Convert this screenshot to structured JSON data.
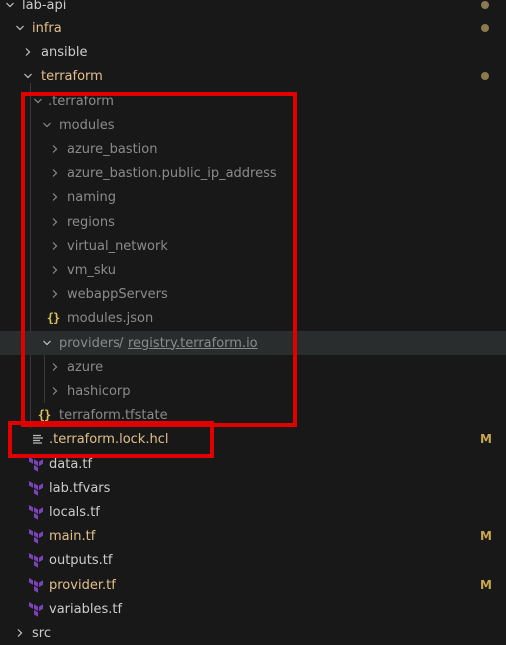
{
  "tree": {
    "lab_api": "lab-api",
    "infra": "infra",
    "ansible": "ansible",
    "terraform": "terraform",
    "dot_terraform": ".terraform",
    "modules": "modules",
    "azure_bastion": "azure_bastion",
    "azure_bastion_pip": "azure_bastion.public_ip_address",
    "naming": "naming",
    "regions": "regions",
    "virtual_network": "virtual_network",
    "vm_sku": "vm_sku",
    "webappServers": "webappServers",
    "modules_json": "modules.json",
    "providers": "providers",
    "providers_sep": "/",
    "registry": "registry.terraform.io",
    "azure": "azure",
    "hashicorp": "hashicorp",
    "tfstate": "terraform.tfstate",
    "lock_hcl": ".terraform.lock.hcl",
    "data_tf": "data.tf",
    "lab_tfvars": "lab.tfvars",
    "locals_tf": "locals.tf",
    "main_tf": "main.tf",
    "outputs_tf": "outputs.tf",
    "provider_tf": "provider.tf",
    "variables_tf": "variables.tf",
    "src": "src"
  },
  "badges": {
    "lock_hcl": "M",
    "main_tf": "M",
    "provider_tf": "M"
  },
  "colors": {
    "background": "#181818",
    "text": "#cccccc",
    "modified": "#e2c08d",
    "badge": "#c9a64f",
    "highlight_box": "#e00000",
    "terraform_icon": "#7b42bc"
  }
}
